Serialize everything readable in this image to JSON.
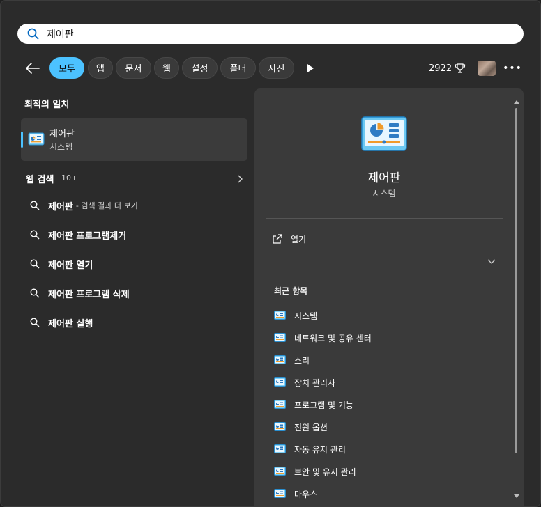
{
  "search": {
    "query": "제어판"
  },
  "filters": {
    "back": "back",
    "chips": [
      "모두",
      "앱",
      "문서",
      "웹",
      "설정",
      "폴더",
      "사진"
    ],
    "active_index": 0,
    "points": "2922"
  },
  "best_match": {
    "heading": "최적의 일치",
    "title": "제어판",
    "subtitle": "시스템"
  },
  "web_search": {
    "heading": "웹 검색",
    "count": "10+",
    "items": [
      {
        "query": "제어판",
        "suffix": "- 검색 결과 더 보기"
      },
      {
        "query": "제어판 프로그램제거",
        "suffix": ""
      },
      {
        "query": "제어판 열기",
        "suffix": ""
      },
      {
        "query": "제어판 프로그램 삭제",
        "suffix": ""
      },
      {
        "query": "제어판 실행",
        "suffix": ""
      }
    ]
  },
  "detail": {
    "title": "제어판",
    "subtitle": "시스템",
    "open_label": "열기",
    "recent_heading": "최근 항목",
    "recent": [
      "시스템",
      "네트워크 및 공유 센터",
      "소리",
      "장치 관리자",
      "프로그램 및 기능",
      "전원 옵션",
      "자동 유지 관리",
      "보안 및 유지 관리",
      "마우스"
    ]
  }
}
